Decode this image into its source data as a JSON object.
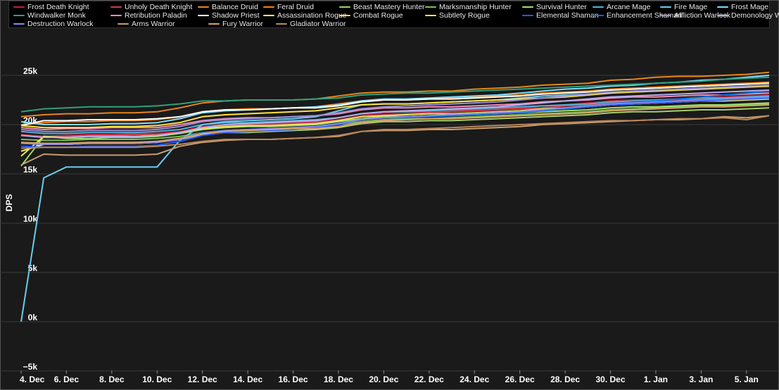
{
  "chart_data": {
    "type": "line",
    "title": "",
    "xlabel": "",
    "ylabel": "DPS",
    "ylim": [
      -5000,
      27500
    ],
    "grid": true,
    "legend_position": "top",
    "x": [
      "4. Dec",
      "5. Dec",
      "6. Dec",
      "7. Dec",
      "8. Dec",
      "9. Dec",
      "10. Dec",
      "11. Dec",
      "12. Dec",
      "13. Dec",
      "14. Dec",
      "15. Dec",
      "16. Dec",
      "17. Dec",
      "18. Dec",
      "19. Dec",
      "20. Dec",
      "21. Dec",
      "22. Dec",
      "23. Dec",
      "24. Dec",
      "25. Dec",
      "26. Dec",
      "27. Dec",
      "28. Dec",
      "29. Dec",
      "30. Dec",
      "31. Dec",
      "1. Jan",
      "2. Jan",
      "3. Jan",
      "4. Jan",
      "5. Jan",
      "6. Jan"
    ],
    "x_tick_labels": [
      "4. Dec",
      "6. Dec",
      "8. Dec",
      "10. Dec",
      "12. Dec",
      "14. Dec",
      "16. Dec",
      "18. Dec",
      "20. Dec",
      "22. Dec",
      "24. Dec",
      "26. Dec",
      "28. Dec",
      "30. Dec",
      "1. Jan",
      "3. Jan",
      "5. Jan"
    ],
    "y_ticks": [
      -5000,
      0,
      5000,
      10000,
      15000,
      20000,
      25000
    ],
    "y_tick_labels": [
      "−5k",
      "0k",
      "5k",
      "10k",
      "15k",
      "20k",
      "25k"
    ],
    "series": [
      {
        "name": "Frost Death Knight",
        "color": "#c41f3b",
        "values": [
          19000,
          18800,
          18900,
          19000,
          19000,
          19100,
          19100,
          19300,
          19800,
          20000,
          20000,
          20100,
          20200,
          20300,
          20500,
          20900,
          21200,
          21300,
          21300,
          21400,
          21500,
          21600,
          21700,
          21900,
          22000,
          22200,
          22400,
          22500,
          22500,
          22600,
          22700,
          22800,
          22900,
          23000
        ]
      },
      {
        "name": "Unholy Death Knight",
        "color": "#d13a4e",
        "values": [
          18900,
          18800,
          18800,
          18900,
          18900,
          19000,
          19000,
          19200,
          19700,
          19900,
          19900,
          20000,
          20100,
          20200,
          20400,
          20800,
          21000,
          21100,
          21200,
          21300,
          21400,
          21500,
          21600,
          21700,
          21900,
          22000,
          22200,
          22300,
          22400,
          22500,
          22600,
          22700,
          22800,
          22900
        ]
      },
      {
        "name": "Balance Druid",
        "color": "#e8841a",
        "values": [
          20800,
          21000,
          21100,
          21100,
          21200,
          21200,
          21300,
          21700,
          22200,
          22400,
          22500,
          22500,
          22500,
          22600,
          22900,
          23200,
          23300,
          23300,
          23400,
          23400,
          23600,
          23700,
          23800,
          24000,
          24100,
          24200,
          24500,
          24600,
          24800,
          24900,
          24900,
          25000,
          25100,
          25300
        ]
      },
      {
        "name": "Feral Druid",
        "color": "#ff7d0a",
        "values": [
          20000,
          20200,
          20300,
          20300,
          20400,
          20400,
          20500,
          20800,
          21300,
          21500,
          21600,
          21600,
          21700,
          21800,
          22100,
          22400,
          22500,
          22500,
          22600,
          22700,
          22800,
          22900,
          23000,
          23200,
          23300,
          23400,
          23600,
          23700,
          23800,
          23900,
          24000,
          24100,
          24200,
          24300
        ]
      },
      {
        "name": "Beast Mastery Hunter",
        "color": "#a5cf6a",
        "values": [
          18200,
          18000,
          18000,
          18100,
          18100,
          18200,
          18200,
          18500,
          19000,
          19200,
          19200,
          19300,
          19400,
          19500,
          19700,
          20100,
          20300,
          20300,
          20400,
          20400,
          20500,
          20600,
          20700,
          20800,
          20900,
          21000,
          21200,
          21300,
          21300,
          21400,
          21500,
          21500,
          21600,
          21700
        ]
      },
      {
        "name": "Marksmanship Hunter",
        "color": "#7cc050",
        "values": [
          18500,
          18400,
          18400,
          18500,
          18500,
          18500,
          18600,
          18800,
          19200,
          19400,
          19500,
          19500,
          19600,
          19700,
          20000,
          20300,
          20500,
          20600,
          20600,
          20700,
          20800,
          20900,
          21000,
          21100,
          21200,
          21300,
          21500,
          21600,
          21700,
          21800,
          21900,
          21900,
          22000,
          22100
        ]
      },
      {
        "name": "Survival Hunter",
        "color": "#9fe070",
        "values": [
          15800,
          18800,
          18600,
          18600,
          18700,
          18700,
          18800,
          19100,
          19500,
          19700,
          19800,
          19800,
          19900,
          20000,
          20300,
          20600,
          20800,
          20800,
          20900,
          20900,
          21000,
          21100,
          21200,
          21300,
          21400,
          21500,
          21700,
          21800,
          21800,
          21900,
          22000,
          22000,
          22100,
          22200
        ]
      },
      {
        "name": "Arcane Mage",
        "color": "#54b3d6",
        "values": [
          19300,
          19100,
          19100,
          19200,
          19200,
          19200,
          19300,
          19500,
          20000,
          20200,
          20200,
          20300,
          20400,
          20500,
          20700,
          21100,
          21300,
          21300,
          21400,
          21500,
          21600,
          21700,
          21800,
          21900,
          22000,
          22100,
          22300,
          22400,
          22500,
          22600,
          22700,
          22700,
          22800,
          22900
        ]
      },
      {
        "name": "Fire Mage",
        "color": "#69ccf0",
        "values": [
          0,
          14600,
          15700,
          15700,
          15700,
          15700,
          15700,
          18400,
          20000,
          20300,
          20400,
          20500,
          20600,
          20800,
          21400,
          22000,
          22100,
          22100,
          22200,
          22300,
          22400,
          22500,
          22700,
          22900,
          23000,
          23100,
          23300,
          23400,
          23500,
          23600,
          23700,
          23800,
          23900,
          24000
        ]
      },
      {
        "name": "Frost Mage",
        "color": "#7fdfff",
        "values": [
          20300,
          20000,
          20000,
          20000,
          20100,
          20100,
          20200,
          20600,
          21200,
          21400,
          21500,
          21600,
          21700,
          21800,
          22000,
          22400,
          22600,
          22600,
          22700,
          22800,
          22900,
          23000,
          23200,
          23400,
          23600,
          23700,
          23900,
          24000,
          24200,
          24300,
          24500,
          24600,
          24800,
          25000
        ]
      },
      {
        "name": "Windwalker Monk",
        "color": "#2fa07c",
        "values": [
          21300,
          21600,
          21700,
          21800,
          21800,
          21800,
          21900,
          22100,
          22400,
          22400,
          22500,
          22500,
          22500,
          22600,
          22700,
          23000,
          23100,
          23200,
          23200,
          23300,
          23400,
          23500,
          23600,
          23700,
          23800,
          23900,
          24000,
          24100,
          24200,
          24300,
          24400,
          24600,
          24700,
          24800
        ]
      },
      {
        "name": "Retribution Paladin",
        "color": "#f58cba",
        "values": [
          19700,
          19500,
          19600,
          19600,
          19700,
          19700,
          19700,
          20000,
          20400,
          20600,
          20700,
          20700,
          20800,
          20900,
          21100,
          21500,
          21700,
          21700,
          21800,
          21800,
          21900,
          22000,
          22100,
          22300,
          22400,
          22500,
          22700,
          22800,
          22800,
          22900,
          23000,
          23000,
          23100,
          23200
        ]
      },
      {
        "name": "Shadow Priest",
        "color": "#ffffff",
        "values": [
          19900,
          20400,
          20400,
          20500,
          20500,
          20500,
          20600,
          20800,
          21300,
          21500,
          21500,
          21600,
          21700,
          21700,
          21900,
          22300,
          22500,
          22500,
          22600,
          22600,
          22700,
          22800,
          22900,
          23100,
          23200,
          23300,
          23500,
          23600,
          23700,
          23800,
          23900,
          24000,
          24100,
          24200
        ]
      },
      {
        "name": "Assassination Rogue",
        "color": "#fff569",
        "values": [
          17300,
          18000,
          18000,
          18100,
          18100,
          18100,
          18200,
          18500,
          19000,
          19300,
          19400,
          19500,
          19600,
          19700,
          20100,
          20500,
          20700,
          20800,
          20900,
          21000,
          21100,
          21200,
          21300,
          21500,
          21600,
          21800,
          22000,
          22100,
          22200,
          22300,
          22400,
          22500,
          22600,
          22700
        ]
      },
      {
        "name": "Combat Rogue",
        "color": "#ffe33c",
        "values": [
          19900,
          19700,
          19700,
          19700,
          19800,
          19800,
          19900,
          20200,
          20800,
          21000,
          21100,
          21200,
          21300,
          21400,
          21700,
          22000,
          22100,
          22100,
          22200,
          22300,
          22400,
          22500,
          22600,
          22700,
          22800,
          23000,
          23200,
          23300,
          23400,
          23500,
          23600,
          23700,
          23800,
          23900
        ]
      },
      {
        "name": "Subtlety Rogue",
        "color": "#e8e85a",
        "values": [
          16800,
          18800,
          18700,
          18800,
          18800,
          18800,
          18900,
          19200,
          19600,
          19800,
          19900,
          19900,
          20000,
          20100,
          20400,
          20800,
          20900,
          21000,
          21100,
          21100,
          21200,
          21300,
          21400,
          21600,
          21700,
          21800,
          22000,
          22100,
          22200,
          22300,
          22400,
          22400,
          22500,
          22600
        ]
      },
      {
        "name": "Elemental Shaman",
        "color": "#2459ff",
        "values": [
          17800,
          17700,
          17700,
          17800,
          17800,
          17800,
          17900,
          18300,
          18900,
          19200,
          19300,
          19400,
          19500,
          19700,
          20000,
          20500,
          20700,
          20800,
          20900,
          21000,
          21100,
          21200,
          21300,
          21500,
          21700,
          21800,
          22000,
          22100,
          22200,
          22300,
          22400,
          22500,
          22600,
          22700
        ]
      },
      {
        "name": "Enhancement Shaman",
        "color": "#0070de",
        "values": [
          18200,
          18100,
          18100,
          18200,
          18200,
          18200,
          18300,
          18600,
          19200,
          19400,
          19500,
          19600,
          19700,
          19800,
          20100,
          20500,
          20700,
          20700,
          20800,
          20900,
          21000,
          21100,
          21200,
          21400,
          21600,
          21800,
          22100,
          22300,
          22400,
          22600,
          22800,
          23000,
          23200,
          23400
        ]
      },
      {
        "name": "Affliction Warlock",
        "color": "#9a8fd8",
        "values": [
          19500,
          19300,
          19300,
          19400,
          19400,
          19400,
          19500,
          19800,
          20300,
          20500,
          20600,
          20700,
          20800,
          20900,
          21200,
          21600,
          21800,
          21900,
          22000,
          22100,
          22200,
          22300,
          22500,
          22700,
          22900,
          23100,
          23300,
          23400,
          23500,
          23600,
          23700,
          23800,
          23900,
          24000
        ]
      },
      {
        "name": "Demonology Warlock",
        "color": "#b5aef0",
        "values": [
          18900,
          18700,
          18700,
          18800,
          18800,
          18800,
          18900,
          19200,
          19700,
          20000,
          20100,
          20200,
          20300,
          20400,
          20700,
          21100,
          21300,
          21400,
          21500,
          21600,
          21700,
          21800,
          22000,
          22200,
          22400,
          22600,
          22800,
          22900,
          23000,
          23100,
          23200,
          23300,
          23400,
          23500
        ]
      },
      {
        "name": "Destruction Warlock",
        "color": "#8787ed",
        "values": [
          18100,
          18000,
          18000,
          18100,
          18100,
          18100,
          18200,
          18500,
          19100,
          19400,
          19500,
          19600,
          19700,
          19800,
          20100,
          20500,
          20700,
          20800,
          20900,
          21000,
          21100,
          21200,
          21300,
          21500,
          21700,
          21900,
          22100,
          22200,
          22300,
          22400,
          22500,
          22600,
          22700,
          22800
        ]
      },
      {
        "name": "Arms Warrior",
        "color": "#c79c6e",
        "values": [
          15900,
          17000,
          16900,
          16900,
          16900,
          16900,
          17000,
          17800,
          18200,
          18400,
          18500,
          18500,
          18600,
          18700,
          18800,
          19300,
          19400,
          19400,
          19500,
          19500,
          19600,
          19700,
          19800,
          20000,
          20100,
          20200,
          20300,
          20400,
          20500,
          20500,
          20600,
          20800,
          20700,
          20900
        ]
      },
      {
        "name": "Fury Warrior",
        "color": "#d9a06a",
        "values": [
          18200,
          18100,
          18100,
          18200,
          18200,
          18200,
          18300,
          18600,
          19100,
          19300,
          19400,
          19500,
          19600,
          19600,
          19800,
          20200,
          20400,
          20500,
          20600,
          20600,
          20700,
          20800,
          20900,
          21000,
          21100,
          21200,
          21400,
          21500,
          21600,
          21700,
          21800,
          21800,
          21900,
          22000
        ]
      },
      {
        "name": "Gladiator Warrior",
        "color": "#b8875a",
        "values": [
          17600,
          17700,
          17700,
          17700,
          17700,
          17700,
          17800,
          18000,
          18300,
          18500,
          18500,
          18500,
          18600,
          18700,
          18900,
          19300,
          19500,
          19500,
          19600,
          19700,
          19800,
          19900,
          20000,
          20100,
          20200,
          20300,
          20400,
          20400,
          20500,
          20600,
          20600,
          20700,
          20500,
          20900
        ]
      }
    ]
  }
}
